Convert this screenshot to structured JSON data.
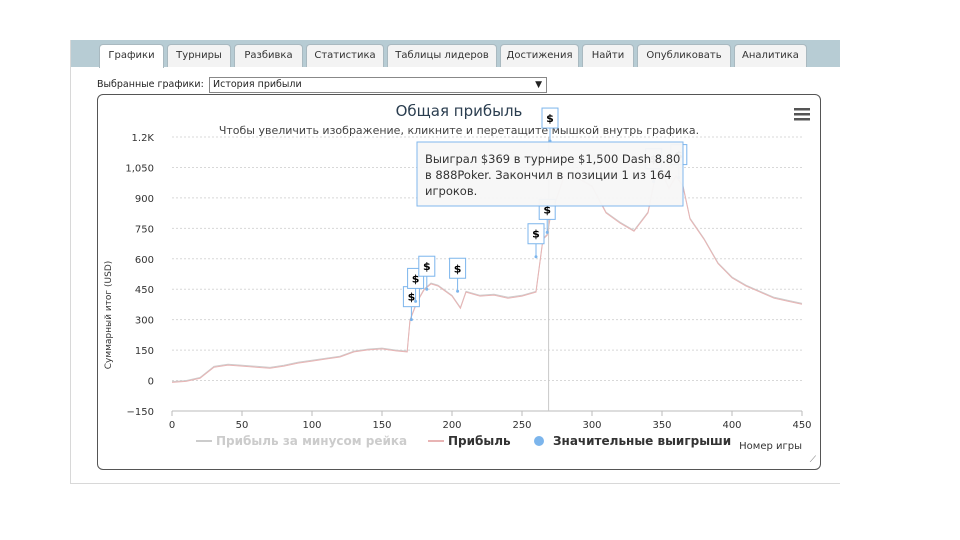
{
  "tabs": [
    "Графики",
    "Турниры",
    "Разбивка",
    "Статистика",
    "Таблицы лидеров",
    "Достижения",
    "Найти",
    "Опубликовать",
    "Аналитика"
  ],
  "active_tab": "Графики",
  "selector": {
    "label": "Выбранные графики:",
    "value": "История прибыли"
  },
  "chart_data": {
    "type": "line",
    "title": "Общая прибыль",
    "subtitle": "Чтобы увеличить изображение, кликните и перетащите мышкой внутрь графика.",
    "xlabel": "Номер игры",
    "ylabel": "Суммарный итог (USD)",
    "xlim": [
      0,
      450
    ],
    "ylim": [
      -150,
      1200
    ],
    "xticks": [
      0,
      50,
      100,
      150,
      200,
      250,
      300,
      350,
      400,
      450
    ],
    "yticks": [
      -150,
      0,
      150,
      300,
      450,
      600,
      750,
      900,
      1050,
      1200
    ],
    "ytick_labels": [
      "−150",
      "0",
      "150",
      "300",
      "450",
      "600",
      "750",
      "900",
      "1,050",
      "1.2K"
    ],
    "series": [
      {
        "name": "Прибыль за минусом рейка",
        "color": "#cccccc",
        "x": [
          0,
          10,
          20,
          30,
          40,
          50,
          60,
          70,
          80,
          90,
          100,
          110,
          120,
          130,
          140,
          150,
          160,
          168,
          170,
          175,
          180,
          185,
          190,
          200,
          206,
          210,
          220,
          230,
          240,
          250,
          260,
          265,
          268,
          270,
          280,
          290,
          300,
          310,
          320,
          330,
          340,
          345,
          350,
          355,
          360,
          365,
          370,
          380,
          390,
          400,
          410,
          420,
          430,
          440,
          450
        ],
        "y": [
          -5,
          0,
          15,
          70,
          80,
          75,
          70,
          65,
          75,
          90,
          100,
          110,
          120,
          145,
          155,
          160,
          150,
          145,
          300,
          390,
          450,
          480,
          470,
          420,
          360,
          440,
          420,
          425,
          410,
          420,
          440,
          700,
          720,
          800,
          1010,
          1000,
          960,
          830,
          780,
          740,
          830,
          1000,
          1025,
          950,
          1010,
          960,
          800,
          700,
          580,
          510,
          470,
          440,
          410,
          395,
          380
        ]
      },
      {
        "name": "Прибыль",
        "color": "#e8b4b4",
        "x": [
          0,
          10,
          20,
          30,
          40,
          50,
          60,
          70,
          80,
          90,
          100,
          110,
          120,
          130,
          140,
          150,
          160,
          168,
          170,
          175,
          180,
          185,
          190,
          200,
          206,
          210,
          220,
          230,
          240,
          250,
          260,
          265,
          268,
          270,
          280,
          290,
          300,
          310,
          320,
          330,
          340,
          345,
          350,
          355,
          360,
          365,
          370,
          380,
          390,
          400,
          410,
          420,
          430,
          440,
          450
        ],
        "y": [
          -5,
          0,
          15,
          70,
          80,
          75,
          70,
          65,
          75,
          90,
          100,
          110,
          120,
          145,
          155,
          160,
          150,
          145,
          300,
          390,
          450,
          480,
          470,
          420,
          360,
          440,
          420,
          425,
          410,
          420,
          440,
          700,
          720,
          800,
          1010,
          1000,
          960,
          830,
          780,
          740,
          830,
          1000,
          1025,
          950,
          1010,
          960,
          800,
          700,
          580,
          510,
          470,
          440,
          410,
          395,
          380
        ]
      }
    ],
    "markers_name": "Значительные выигрыши",
    "markers_color": "#7cb5ec",
    "marker_symbol": "$",
    "marker_points": [
      {
        "x": 171,
        "y": 300
      },
      {
        "x": 174,
        "y": 390
      },
      {
        "x": 182,
        "y": 450
      },
      {
        "x": 204,
        "y": 440
      },
      {
        "x": 260,
        "y": 610
      },
      {
        "x": 268,
        "y": 730
      },
      {
        "x": 270,
        "y": 1180
      },
      {
        "x": 344,
        "y": 980
      },
      {
        "x": 362,
        "y": 1000
      }
    ],
    "crosshair_x": 269,
    "legend_position": "bottom",
    "tooltip": "Выиграл $369 в турнире $1,500 Dash 8.80 в 888Poker. Закончил в позиции 1 из 164 игроков."
  }
}
